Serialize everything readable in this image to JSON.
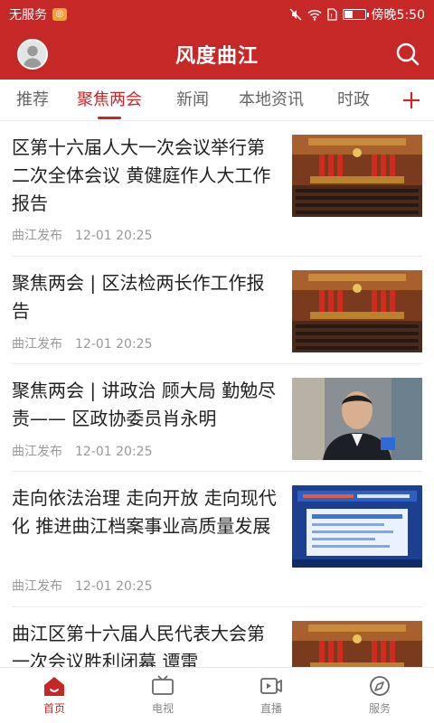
{
  "status_bar": {
    "carrier": "无服务",
    "time": "傍晚5:50",
    "battery_level": 0.4
  },
  "header": {
    "title": "风度曲江"
  },
  "tabs": [
    {
      "label": "推荐",
      "active": false
    },
    {
      "label": "聚焦两会",
      "active": true
    },
    {
      "label": "新闻",
      "active": false
    },
    {
      "label": "本地资讯",
      "active": false
    },
    {
      "label": "时政",
      "active": false
    }
  ],
  "news": [
    {
      "title": "区第十六届人大一次会议举行第二次全体会议 黄健庭作人大工作报告",
      "source": "曲江发布",
      "time": "12-01 20:25",
      "thumb": "conference"
    },
    {
      "title": "聚焦两会 | 区法检两长作工作报告",
      "source": "曲江发布",
      "time": "12-01 20:25",
      "thumb": "conference"
    },
    {
      "title": "聚焦两会 | 讲政治 顾大局 勤勉尽责—— 区政协委员肖永明",
      "source": "曲江发布",
      "time": "12-01 20:25",
      "thumb": "interview"
    },
    {
      "title": "走向依法治理 走向开放 走向现代化 推进曲江档案事业高质量发展",
      "source": "曲江发布",
      "time": "12-01 20:25",
      "thumb": "screen"
    },
    {
      "title": "曲江区第十六届人民代表大会第一次会议胜利闭幕 谭雷",
      "source": "",
      "time": "",
      "thumb": "conference"
    }
  ],
  "bottom_nav": [
    {
      "label": "首页",
      "icon": "home-icon",
      "active": true
    },
    {
      "label": "电视",
      "icon": "tv-icon",
      "active": false
    },
    {
      "label": "直播",
      "icon": "live-icon",
      "active": false
    },
    {
      "label": "服务",
      "icon": "compass-icon",
      "active": false
    }
  ],
  "colors": {
    "brand_red": "#c62828",
    "text": "#222222",
    "meta": "#999999"
  }
}
